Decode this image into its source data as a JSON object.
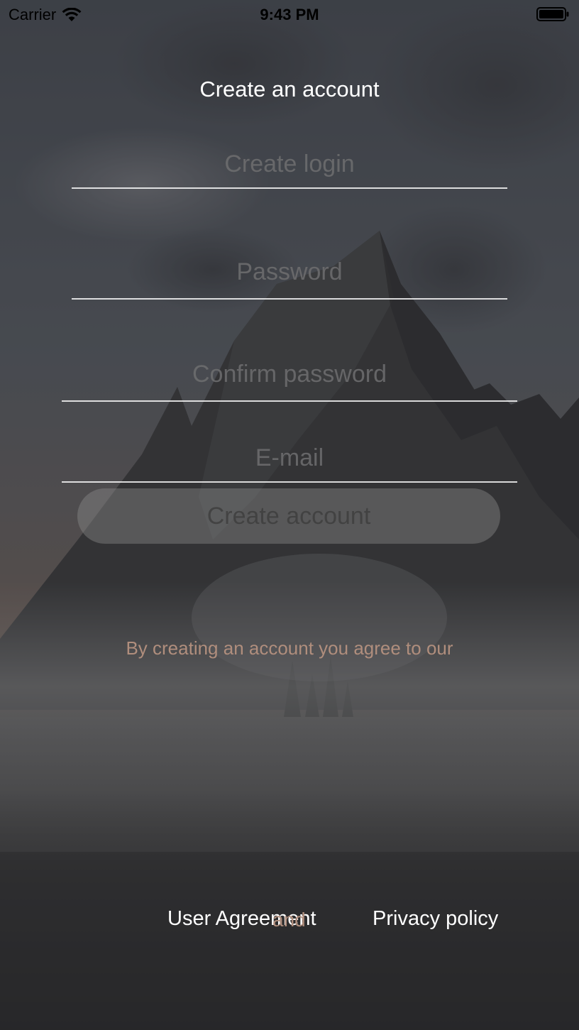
{
  "status_bar": {
    "carrier": "Carrier",
    "time": "9:43 PM",
    "wifi_icon": "wifi-icon",
    "battery_icon": "battery-full-icon"
  },
  "title": "Create an account",
  "form": {
    "login_placeholder": "Create login",
    "login_value": "",
    "password_placeholder": "Password",
    "password_value": "",
    "confirm_placeholder": "Confirm password",
    "confirm_value": "",
    "email_placeholder": "E-mail",
    "email_value": ""
  },
  "create_button_label": "Create account",
  "agreement": {
    "text": "By creating an account you agree to our",
    "user_agreement": "User Agreement",
    "and": "and",
    "privacy_policy": "Privacy policy"
  },
  "colors": {
    "accent_text": "#b08e7d",
    "primary_text": "#ffffff",
    "placeholder": "#6e6e70"
  }
}
